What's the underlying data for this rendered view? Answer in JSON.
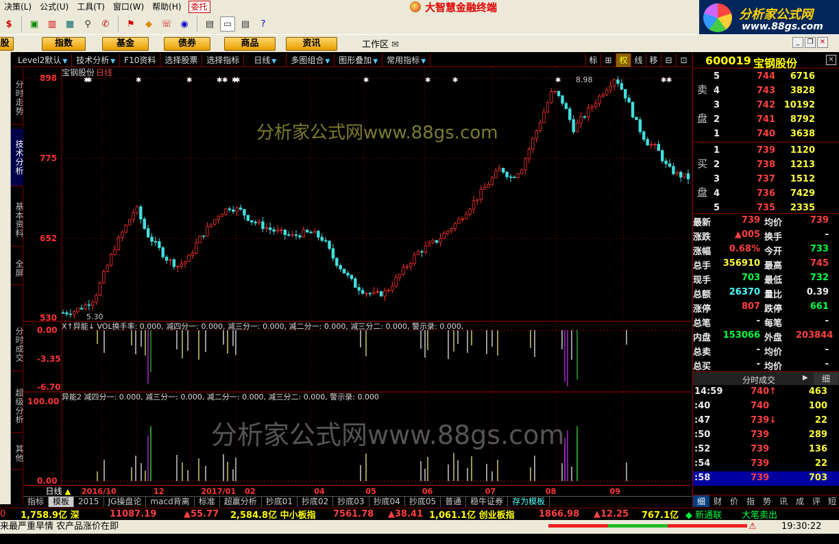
{
  "menu": {
    "items": [
      "决策(L)",
      "公式(U)",
      "工具(T)",
      "窗口(W)",
      "帮助(H)"
    ],
    "trade": "委托"
  },
  "app_title": "大智慧金融终端",
  "brand": {
    "line1": "分析家公式网",
    "line2": "www.88gs.com"
  },
  "nav": {
    "buttons": [
      "股",
      "指数",
      "基金",
      "债券",
      "商品",
      "资讯"
    ],
    "workarea": "工作区"
  },
  "side_tabs": [
    "分时走势",
    "技术分析",
    "基本资料",
    "全屏",
    "分时成交",
    "超级分析",
    "其他"
  ],
  "chart_tools": {
    "items": [
      "Level2默认",
      "技术分析",
      "F10资料",
      "选择股票",
      "选择指标",
      "日线",
      "多图组合",
      "图形叠加",
      "常用指标"
    ],
    "right": [
      "标",
      "⊞",
      "权",
      "线",
      "移",
      "⊟",
      "⊡"
    ]
  },
  "chart": {
    "stock_label": "宝钢股份",
    "period_label": "日线",
    "y_ticks": [
      "898",
      "775",
      "652",
      "530"
    ],
    "high_label": "8.98",
    "low_label": "5.30",
    "watermark": "分析家公式网www.88gs.com",
    "watermark2": "分析家公式网www.88gs.com",
    "ind1_header": "X↑异能↓ VOL换手率: 0.000, 减四分一: 0.000, 减三分一: 0.000, 减二分一: 0.000, 减三分二: 0.000, 警示录: 0.000,",
    "ind1_ticks": [
      "0.00",
      "-3.35",
      "-6.70"
    ],
    "ind2_header": "异能2 减四分一: 0.000, 减三分一: 0.000, 减二分一: 0.000, 减三分二: 0.000, 警示录: 0.000",
    "ind2_ticks": [
      "100.00",
      "0.00"
    ],
    "x_ticks": [
      "2016/10",
      "12",
      "2017/01",
      "02",
      "04",
      "05",
      "06",
      "07",
      "08",
      "09"
    ],
    "period_footer": "日线"
  },
  "chart_data": {
    "type": "candlestick",
    "title": "宝钢股份 日线",
    "ylim": [
      530,
      898
    ],
    "x_ticks": [
      "2016/10",
      "12",
      "2017/01",
      "02",
      "04",
      "05",
      "06",
      "07",
      "08",
      "09"
    ],
    "close_path": [
      538,
      540,
      548,
      560,
      600,
      640,
      670,
      700,
      660,
      640,
      620,
      610,
      620,
      650,
      670,
      690,
      700,
      695,
      680,
      672,
      665,
      660,
      655,
      660,
      660,
      650,
      620,
      600,
      580,
      570,
      565,
      570,
      590,
      610,
      630,
      640,
      650,
      665,
      680,
      700,
      720,
      740,
      760,
      745,
      760,
      800,
      840,
      880,
      860,
      820,
      840,
      860,
      880,
      900,
      870,
      830,
      800,
      790,
      760,
      750,
      745
    ]
  },
  "sub_tabs": [
    "指标",
    "模板",
    "2015",
    "JG操盘论",
    "macd背离",
    "标准",
    "超赢分析",
    "抄底01",
    "抄底02",
    "抄底03",
    "抄底04",
    "抄底05",
    "普通",
    "稳牛证券",
    "存为模板"
  ],
  "ticker1": {
    "items": [
      "0",
      "1,758.9亿 深",
      "11087.19",
      "▲55.77",
      "2,584.8亿 中小板指",
      "7561.78",
      "▲38.41",
      "1,061.1亿 创业板指",
      "1866.98",
      "▲12.25",
      "767.1亿",
      "◆ 新通联",
      "大笔卖出"
    ]
  },
  "ticker2": {
    "text": "来最严重旱情 农产品涨价在即",
    "time": "19:30:22"
  },
  "stock": {
    "code": "600019",
    "name": "宝钢股份"
  },
  "order_book": {
    "sell_label": [
      "卖",
      "盘"
    ],
    "buy_label": [
      "买",
      "盘"
    ],
    "sells": [
      {
        "lvl": "5",
        "price": "744",
        "vol": "6716"
      },
      {
        "lvl": "4",
        "price": "743",
        "vol": "3828"
      },
      {
        "lvl": "3",
        "price": "742",
        "vol": "10192"
      },
      {
        "lvl": "2",
        "price": "741",
        "vol": "8792"
      },
      {
        "lvl": "1",
        "price": "740",
        "vol": "3638"
      }
    ],
    "buys": [
      {
        "lvl": "1",
        "price": "739",
        "vol": "1120"
      },
      {
        "lvl": "2",
        "price": "738",
        "vol": "1213"
      },
      {
        "lvl": "3",
        "price": "737",
        "vol": "1512"
      },
      {
        "lvl": "4",
        "price": "736",
        "vol": "7429"
      },
      {
        "lvl": "5",
        "price": "735",
        "vol": "2335"
      }
    ]
  },
  "quote": [
    {
      "l1": "最新",
      "v1": "739",
      "l2": "均价",
      "v2": "739"
    },
    {
      "l1": "涨跌",
      "v1": "▲005",
      "l2": "换手",
      "v2": "-"
    },
    {
      "l1": "涨幅",
      "v1": "0.68%",
      "l2": "今开",
      "v2": "733"
    },
    {
      "l1": "总手",
      "v1": "356910",
      "l2": "最高",
      "v2": "745"
    },
    {
      "l1": "现手",
      "v1": "703",
      "l2": "最低",
      "v2": "732"
    },
    {
      "l1": "总额",
      "v1": "26370",
      "l2": "量比",
      "v2": "0.39"
    },
    {
      "l1": "涨停",
      "v1": "807",
      "l2": "跌停",
      "v2": "661"
    },
    {
      "l1": "总笔",
      "v1": "-",
      "l2": "每笔",
      "v2": "-"
    },
    {
      "l1": "内盘",
      "v1": "153066",
      "l2": "外盘",
      "v2": "203844"
    },
    {
      "l1": "总卖",
      "v1": "-",
      "l2": "均价",
      "v2": "-"
    },
    {
      "l1": "总买",
      "v1": "-",
      "l2": "均价",
      "v2": "-"
    }
  ],
  "ticks_header": "分时成交",
  "ticks_right": "细",
  "ticks": [
    {
      "t": "14:59",
      "p": "740↑",
      "v": "463"
    },
    {
      "t": ":40",
      "p": "740",
      "v": "100"
    },
    {
      "t": ":47",
      "p": "739↓",
      "v": "22"
    },
    {
      "t": ":50",
      "p": "739",
      "v": "289"
    },
    {
      "t": ":52",
      "p": "739",
      "v": "136"
    },
    {
      "t": ":54",
      "p": "739",
      "v": "22"
    },
    {
      "t": ":58",
      "p": "739",
      "v": "703"
    }
  ],
  "bottom_tabs": [
    "细",
    "财",
    "价",
    "指",
    "势",
    "讯",
    "成",
    "评",
    "短"
  ]
}
